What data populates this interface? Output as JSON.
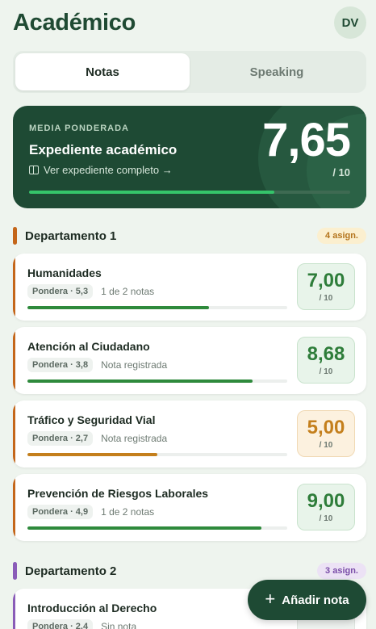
{
  "header": {
    "title": "Académico",
    "avatar": "DV"
  },
  "tabs": [
    {
      "label": "Notas",
      "active": true
    },
    {
      "label": "Speaking",
      "active": false
    }
  ],
  "summary": {
    "label": "MEDIA PONDERADA",
    "title": "Expediente académico",
    "link": "Ver expediente completo →",
    "score": "7,65",
    "out_of": "/ 10",
    "progress": 0.765
  },
  "departments": [
    {
      "name": "Departamento 1",
      "badge": "4 asign.",
      "accent": "#c4661a",
      "badge_bg": "#fbefcf",
      "badge_color": "#b4741d",
      "subjects": [
        {
          "name": "Humanidades",
          "weight": "Pondera · 5,3",
          "notes": "1 de 2 notas",
          "grade": "7,00",
          "out_of": "/ 10",
          "progress": 0.7,
          "status": "green",
          "bar_color": "#2e8a3c"
        },
        {
          "name": "Atención al Ciudadano",
          "weight": "Pondera · 3,8",
          "notes": "Nota registrada",
          "grade": "8,68",
          "out_of": "/ 10",
          "progress": 0.868,
          "status": "green",
          "bar_color": "#2e8a3c"
        },
        {
          "name": "Tráfico y Seguridad Vial",
          "weight": "Pondera · 2,7",
          "notes": "Nota registrada",
          "grade": "5,00",
          "out_of": "/ 10",
          "progress": 0.5,
          "status": "amber",
          "bar_color": "#c47f1c"
        },
        {
          "name": "Prevención de Riesgos Laborales",
          "weight": "Pondera · 4,9",
          "notes": "1 de 2 notas",
          "grade": "9,00",
          "out_of": "/ 10",
          "progress": 0.9,
          "status": "green",
          "bar_color": "#2e8a3c"
        }
      ]
    },
    {
      "name": "Departamento 2",
      "badge": "3 asign.",
      "accent": "#8a5cb8",
      "badge_bg": "#ece2f5",
      "badge_color": "#7a4da8",
      "subjects": [
        {
          "name": "Introducción al Derecho",
          "weight": "Pondera · 2,4",
          "notes": "Sin nota"
        }
      ]
    }
  ],
  "fab": {
    "label": "Añadir nota",
    "icon": "plus-icon"
  }
}
